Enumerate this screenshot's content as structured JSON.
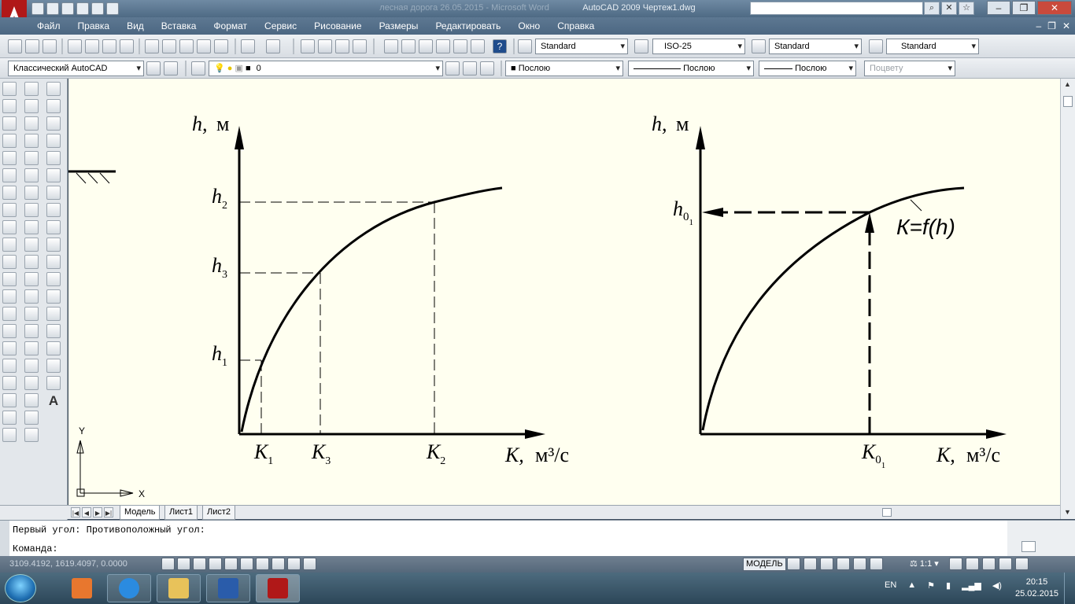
{
  "window": {
    "title": "AutoCAD 2009 Чертеж1.dwg",
    "doc_title": "лесная дорога 26.05.2015 - Microsoft Word"
  },
  "menu": [
    "Файл",
    "Правка",
    "Вид",
    "Вставка",
    "Формат",
    "Сервис",
    "Рисование",
    "Размеры",
    "Редактировать",
    "Окно",
    "Справка"
  ],
  "toolbar": {
    "text_style": "Standard",
    "dim_style": "ISO-25",
    "table_style": "Standard",
    "multileader_style": "Standard",
    "workspace": "Классический AutoCAD",
    "layer": "0",
    "color": "Послою",
    "linetype": "Послою",
    "lineweight": "Послою",
    "plotstyle": "Поцвету"
  },
  "drawing": {
    "left": {
      "ylabel": "h,",
      "ylabel_unit": "м",
      "xlabel": "К,",
      "xlabel_unit": "м³/с",
      "y_ticks": [
        {
          "base": "h",
          "sub": "2"
        },
        {
          "base": "h",
          "sub": "3"
        },
        {
          "base": "h",
          "sub": "1"
        }
      ],
      "x_ticks": [
        {
          "base": "К",
          "sub": "1"
        },
        {
          "base": "К",
          "sub": "3"
        },
        {
          "base": "К",
          "sub": "2"
        }
      ]
    },
    "right": {
      "ylabel": "h,",
      "ylabel_unit": "м",
      "xlabel": "К,",
      "xlabel_unit": "м³/с",
      "y_tick": {
        "base": "h",
        "sub": "0",
        "subsub": "1"
      },
      "x_tick": {
        "base": "К",
        "sub": "0",
        "subsub": "1"
      },
      "curve_label": "К=f(h)"
    },
    "ucs_x": "X",
    "ucs_y": "Y"
  },
  "tabs": [
    "Модель",
    "Лист1",
    "Лист2"
  ],
  "command": {
    "history": "Первый угол: Противоположный угол:",
    "prompt": "Команда:"
  },
  "status": {
    "coordinates": "3109.4192, 1619.4097, 0.0000",
    "space": "МОДЕЛЬ",
    "scale": "1:1"
  },
  "taskbar": {
    "lang": "EN",
    "time": "20:15",
    "date": "25.02.2015"
  }
}
